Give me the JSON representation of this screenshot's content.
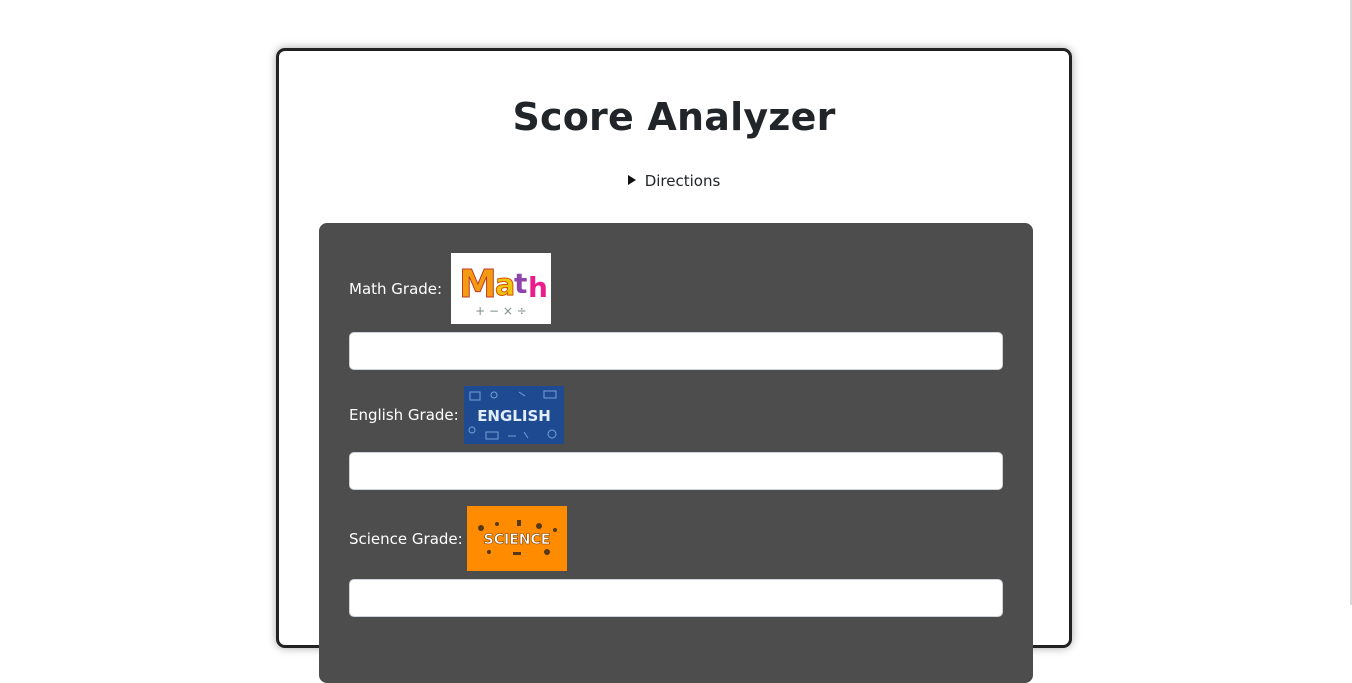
{
  "app": {
    "title": "Score Analyzer",
    "directions_label": "Directions"
  },
  "subjects": [
    {
      "label": "Math Grade:",
      "image_text": "Math",
      "image_symbols": "+ − × ÷",
      "value": "",
      "placeholder": ""
    },
    {
      "label": "English Grade:",
      "image_text": "ENGLISH",
      "value": "",
      "placeholder": ""
    },
    {
      "label": "Science Grade:",
      "image_text": "SCIENCE",
      "value": "",
      "placeholder": ""
    }
  ],
  "colors": {
    "panel": "#4d4d4d",
    "card_border": "#222222",
    "english_bg": "#1e4a92",
    "science_bg": "#ff8c00"
  }
}
